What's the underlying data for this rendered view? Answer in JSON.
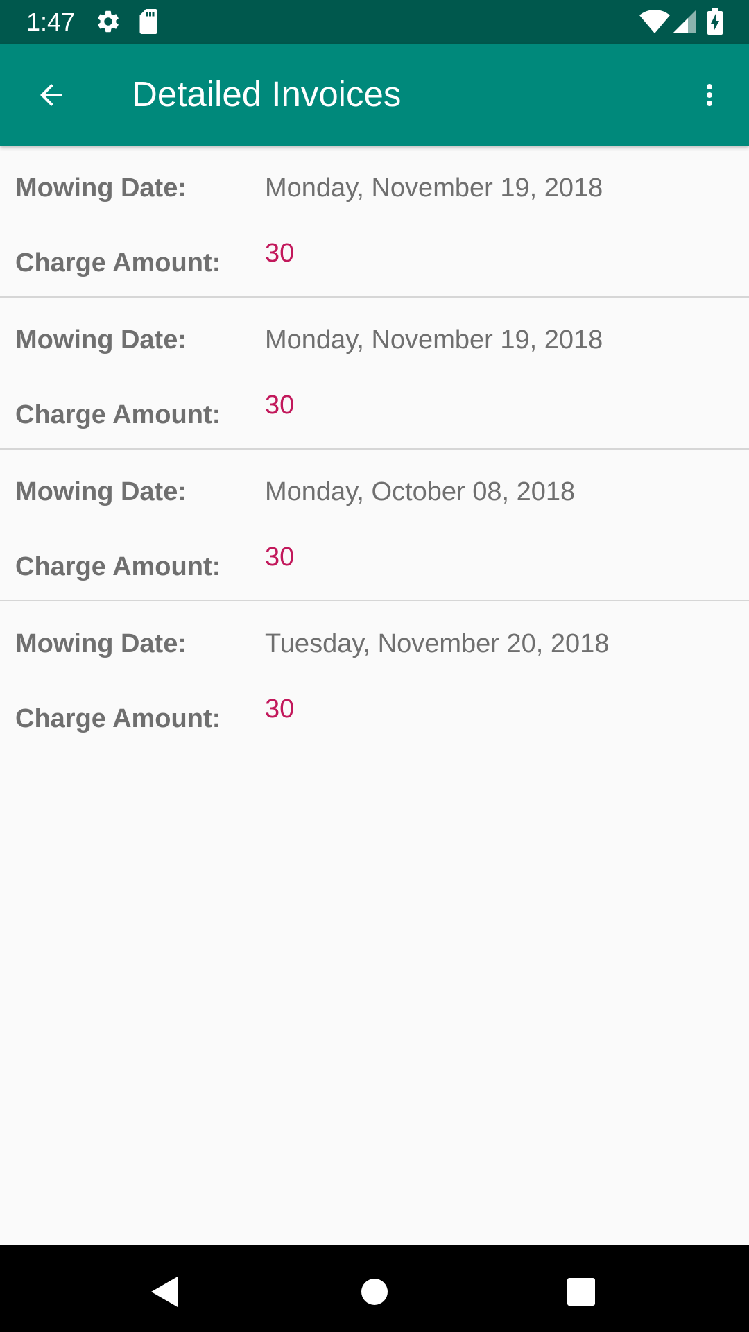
{
  "status_bar": {
    "time": "1:47",
    "icons": [
      "gear-icon",
      "sd-card-icon",
      "wifi-icon",
      "signal-icon",
      "battery-icon"
    ],
    "background_color": "#00584d"
  },
  "app_bar": {
    "title": "Detailed Invoices",
    "background_color": "#00897b",
    "back_icon": "arrow-back-icon",
    "menu_icon": "more-vert-icon"
  },
  "invoices": [
    {
      "date_label": "Mowing Date:",
      "date": "Monday, November 19, 2018",
      "amount_label": "Charge Amount:",
      "amount": "30"
    },
    {
      "date_label": "Mowing Date:",
      "date": "Monday, November 19, 2018",
      "amount_label": "Charge Amount:",
      "amount": "30"
    },
    {
      "date_label": "Mowing Date:",
      "date": "Monday, October 08, 2018",
      "amount_label": "Charge Amount:",
      "amount": "30"
    },
    {
      "date_label": "Mowing Date:",
      "date": "Tuesday, November 20, 2018",
      "amount_label": "Charge Amount:",
      "amount": "30"
    }
  ],
  "colors": {
    "label": "#6f6f6f",
    "amount": "#c2185b",
    "divider": "#d6d6d6"
  },
  "nav_bar": {
    "icons": [
      "back-triangle-icon",
      "home-circle-icon",
      "recents-square-icon"
    ]
  }
}
